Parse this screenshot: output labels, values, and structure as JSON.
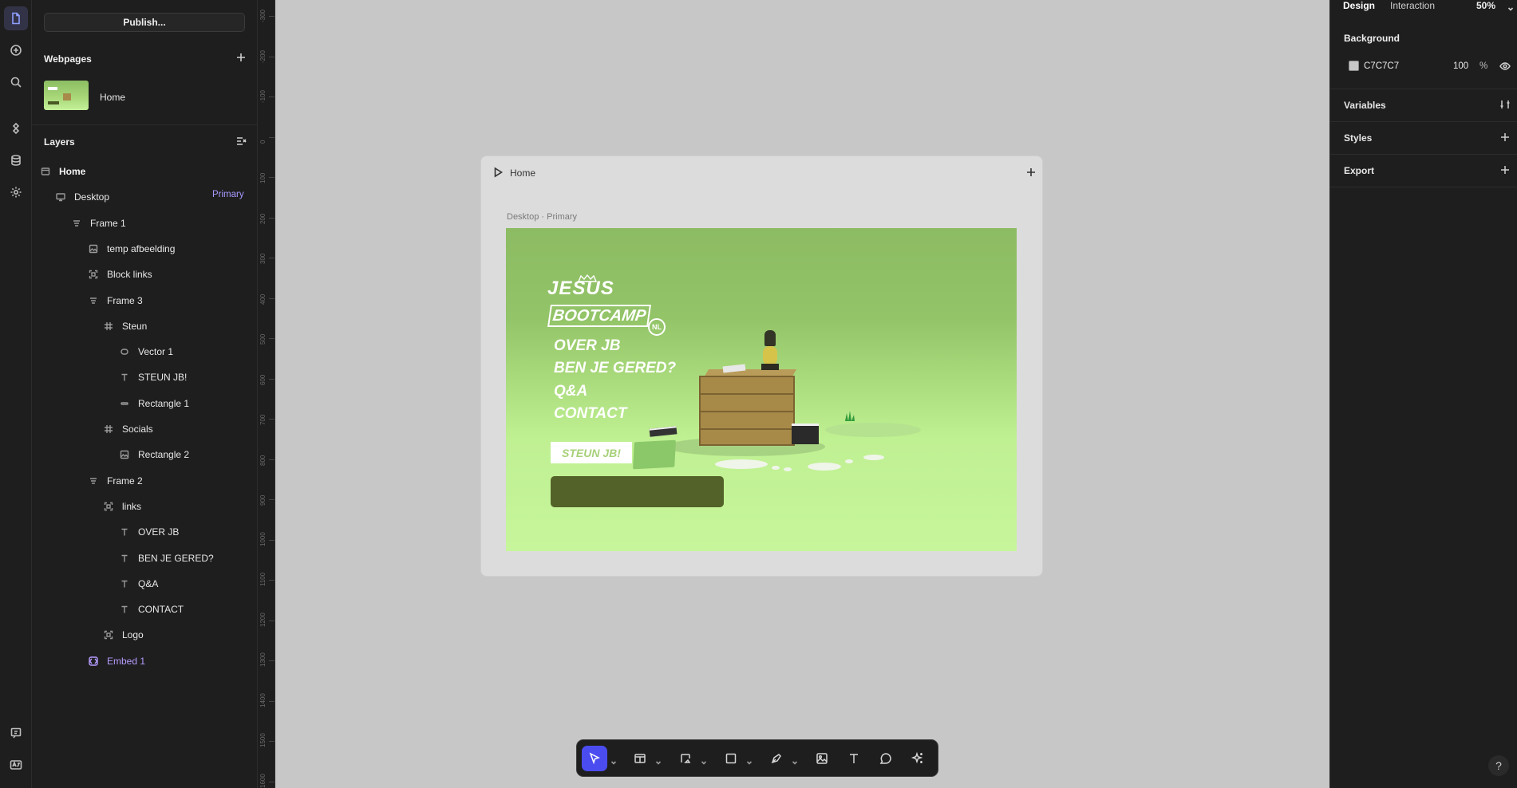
{
  "left_panel": {
    "publish_label": "Publish...",
    "webpages_title": "Webpages",
    "page_name": "Home",
    "layers_title": "Layers",
    "primary_tag": "Primary",
    "layers": [
      {
        "name": "Home",
        "icon": "page-icon",
        "depth": 0
      },
      {
        "name": "Desktop",
        "icon": "desktop-icon",
        "depth": 1
      },
      {
        "name": "Frame 1",
        "icon": "stack-icon",
        "depth": 2
      },
      {
        "name": "temp afbeelding",
        "icon": "image-icon",
        "depth": 3
      },
      {
        "name": "Block links",
        "icon": "component-icon",
        "depth": 3
      },
      {
        "name": "Frame 3",
        "icon": "stack-icon",
        "depth": 4
      },
      {
        "name": "Steun",
        "icon": "frame-icon",
        "depth": 5
      },
      {
        "name": "Vector 1",
        "icon": "vector-icon",
        "depth": 6
      },
      {
        "name": "STEUN JB!",
        "icon": "text-icon",
        "depth": 6
      },
      {
        "name": "Rectangle 1",
        "icon": "rectangle-icon",
        "depth": 6
      },
      {
        "name": "Socials",
        "icon": "frame-icon",
        "depth": 5
      },
      {
        "name": "Rectangle 2",
        "icon": "image-icon",
        "depth": 6
      },
      {
        "name": "Frame 2",
        "icon": "stack-icon",
        "depth": 4
      },
      {
        "name": "links",
        "icon": "component-icon",
        "depth": 5
      },
      {
        "name": "OVER JB",
        "icon": "text-icon",
        "depth": 6
      },
      {
        "name": "BEN JE GERED?",
        "icon": "text-icon",
        "depth": 6
      },
      {
        "name": "Q&A",
        "icon": "text-icon",
        "depth": 6
      },
      {
        "name": "CONTACT",
        "icon": "text-icon",
        "depth": 6
      },
      {
        "name": "Logo",
        "icon": "component-icon",
        "depth": 5
      },
      {
        "name": "Embed 1",
        "icon": "embed-icon",
        "depth": 3
      }
    ]
  },
  "ruler": {
    "ticks": [
      "-300",
      "-200",
      "-100",
      "0",
      "100",
      "200",
      "300",
      "400",
      "500",
      "600",
      "700",
      "800",
      "900",
      "1000",
      "1100",
      "1200",
      "1300",
      "1400",
      "1500",
      "1600"
    ]
  },
  "canvas": {
    "frame_title": "Home",
    "breakpoint_label": "Desktop · Primary",
    "preview": {
      "logo_top": "JESUS",
      "logo_bottom": "BOOTCAMP",
      "logo_badge": "NL",
      "nav": [
        "OVER JB",
        "BEN JE GERED?",
        "Q&A",
        "CONTACT"
      ],
      "cta": "STEUN JB!"
    }
  },
  "toolbar": {
    "tools": [
      "select-icon",
      "insert-icon",
      "frame-tool-icon",
      "rectangle-tool-icon",
      "pen-tool-icon",
      "image-tool-icon",
      "text-tool-icon",
      "comment-icon",
      "ai-sparkle-icon"
    ]
  },
  "right_panel": {
    "tab_design": "Design",
    "tab_interaction": "Interaction",
    "zoom": "50%",
    "background_title": "Background",
    "background_hex": "C7C7C7",
    "background_opacity": "100",
    "background_opacity_unit": "%",
    "variables_title": "Variables",
    "styles_title": "Styles",
    "export_title": "Export",
    "help": "?"
  },
  "colors": {
    "canvas_bg": "#c7c7c7",
    "panel_bg": "#1e1e1e",
    "accent": "#4b4cf0",
    "primary_tag": "#a79aff",
    "embed_purple": "#b69cff",
    "preview_green": "#93c468"
  }
}
